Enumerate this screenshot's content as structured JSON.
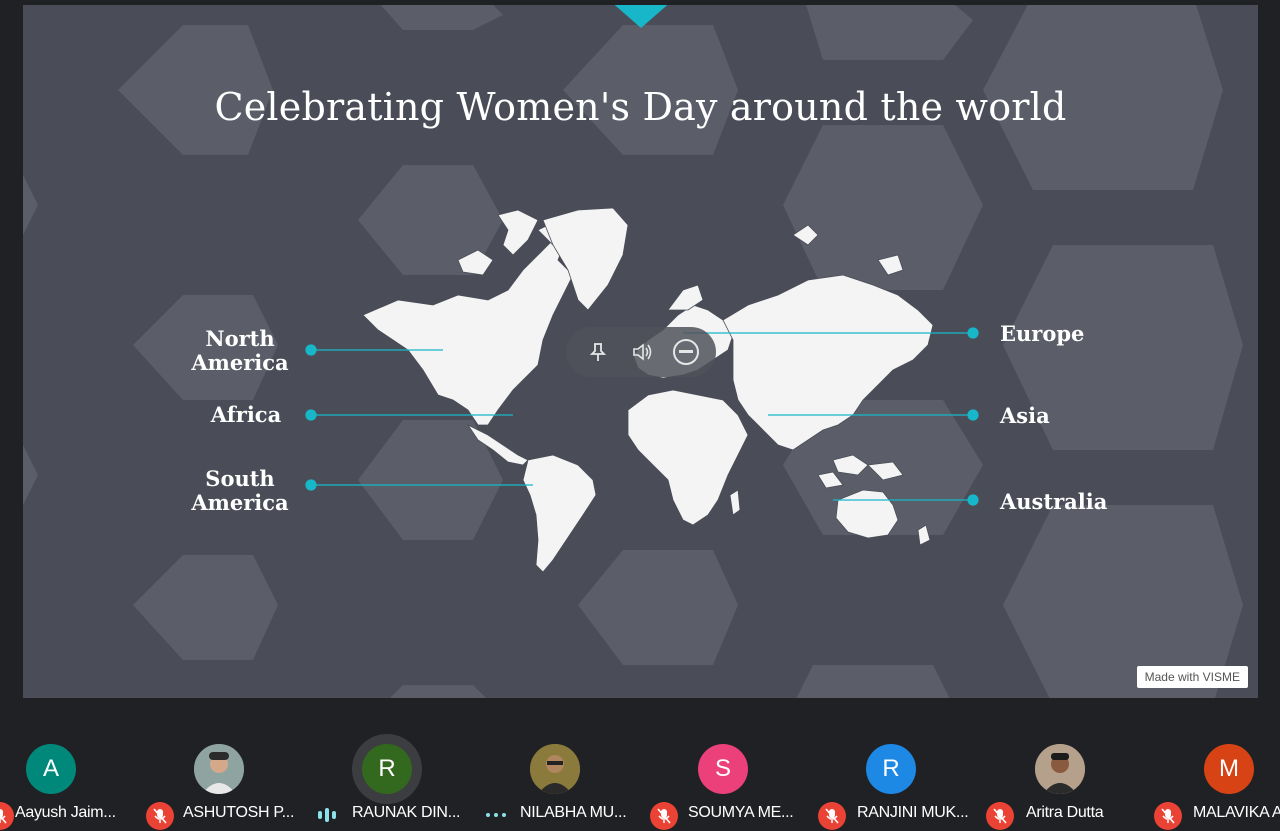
{
  "slide": {
    "title": "Celebrating Women's Day around the world",
    "watermark": "Made with VISME",
    "labels_left": [
      "North\nAmerica",
      "Africa",
      "South\nAmerica"
    ],
    "labels_right": [
      "Europe",
      "Asia",
      "Australia"
    ],
    "accent_color": "#17b7c9",
    "background_color": "#4a4d57"
  },
  "overlay_controls": [
    {
      "icon": "pin-icon"
    },
    {
      "icon": "volume-icon"
    },
    {
      "icon": "remove-icon"
    }
  ],
  "participants": [
    {
      "initial": "A",
      "name": "Aayush Jaim...",
      "avatar_color": "#00897b",
      "status": "mic-off"
    },
    {
      "initial": "",
      "name": "ASHUTOSH P...",
      "avatar_color": "#6d7b7a",
      "status": "mic-off",
      "photo": true
    },
    {
      "initial": "R",
      "name": "RAUNAK DIN...",
      "avatar_color": "#33691e",
      "status": "speaking"
    },
    {
      "initial": "",
      "name": "NILABHA MU...",
      "avatar_color": "#7a6a3a",
      "status": "more",
      "photo": true
    },
    {
      "initial": "S",
      "name": "SOUMYA ME...",
      "avatar_color": "#ec407a",
      "status": "mic-off"
    },
    {
      "initial": "R",
      "name": "RANJINI MUK...",
      "avatar_color": "#1e88e5",
      "status": "mic-off"
    },
    {
      "initial": "",
      "name": "Aritra Dutta",
      "avatar_color": "#9a7b66",
      "status": "mic-off",
      "photo": true
    },
    {
      "initial": "M",
      "name": "MALAVIKA A",
      "avatar_color": "#d84315",
      "status": "mic-off"
    }
  ]
}
